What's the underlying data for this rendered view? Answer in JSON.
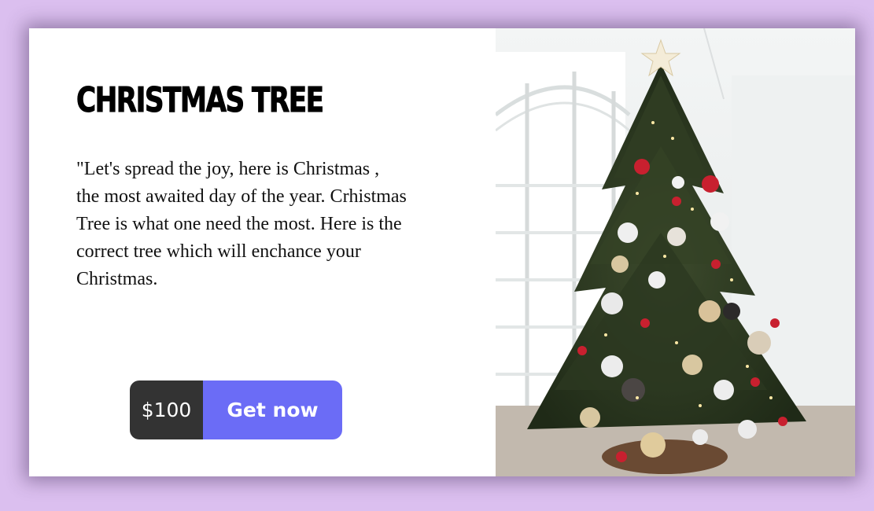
{
  "product": {
    "title": "Christmas Tree",
    "description": "\"Let's spread the joy, here is Christmas , the most awaited day of the year. Crhistmas Tree is what one need the most. Here is the correct tree which will enchance your Christmas.",
    "price": "$100",
    "cta_label": "Get now"
  },
  "image": {
    "subject": "decorated christmas tree by a window"
  },
  "colors": {
    "page_background": "#dbbfef",
    "card_background": "#ffffff",
    "price_background": "#333333",
    "button_background": "#6b6cf6",
    "button_text": "#ffffff"
  }
}
